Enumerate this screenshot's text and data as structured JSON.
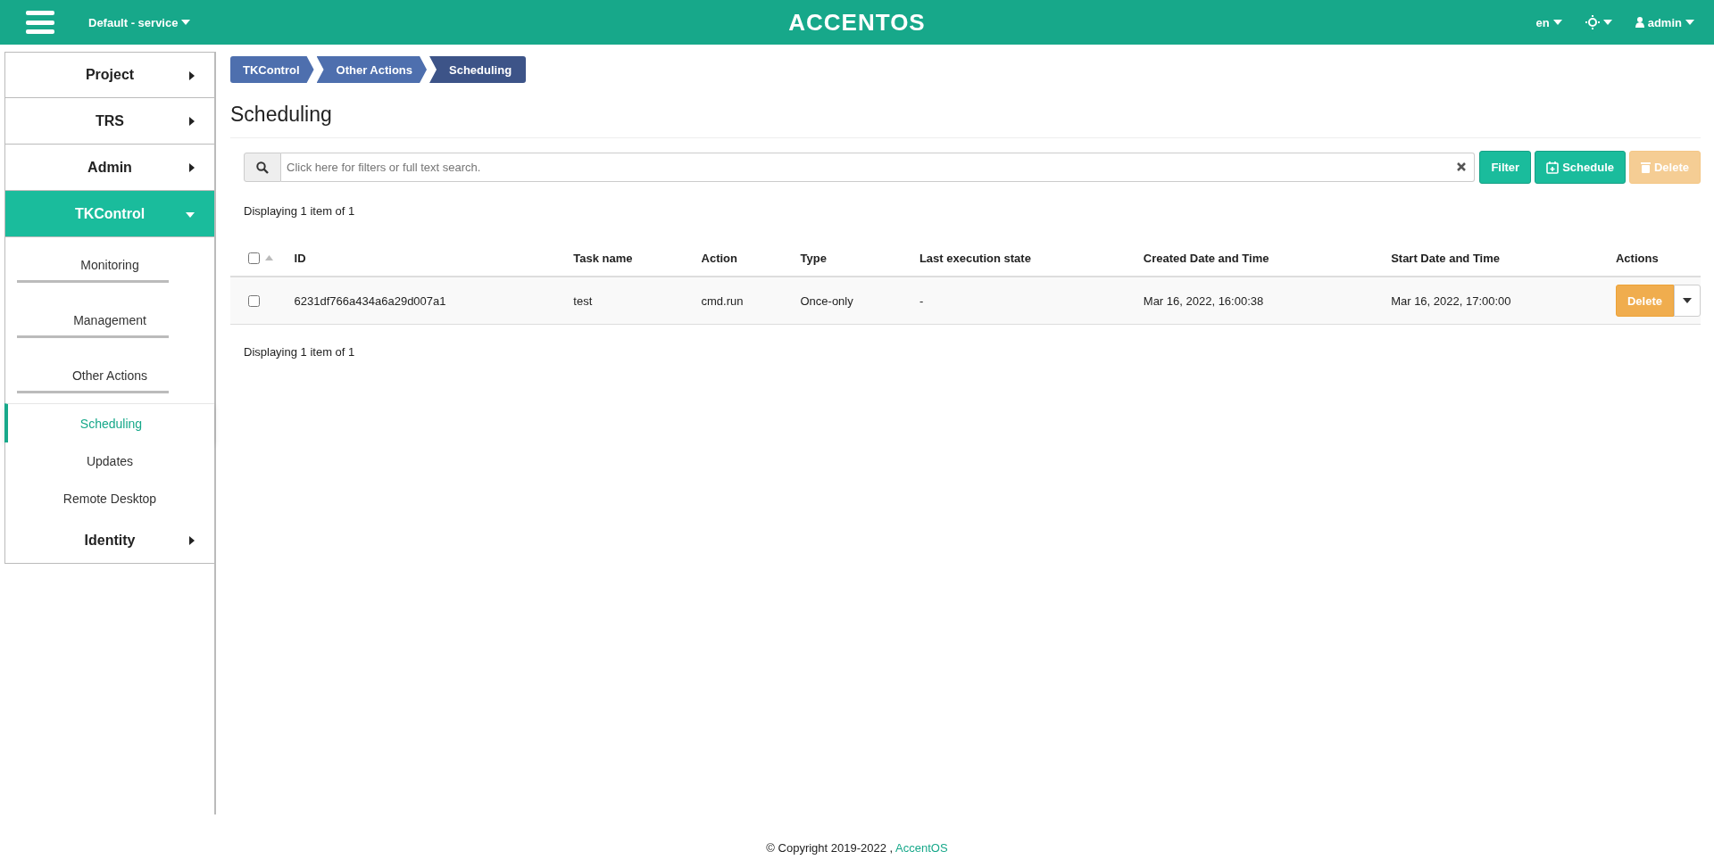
{
  "header": {
    "project": "Default - service",
    "logo": "ACCENTOS",
    "language": "en",
    "user": "admin"
  },
  "sidebar": {
    "items": [
      {
        "label": "Project",
        "expanded": false,
        "selected": false
      },
      {
        "label": "TRS",
        "expanded": false,
        "selected": false
      },
      {
        "label": "Admin",
        "expanded": false,
        "selected": false
      },
      {
        "label": "TKControl",
        "expanded": true,
        "selected": true,
        "children": [
          {
            "label": "Monitoring",
            "kind": "group"
          },
          {
            "label": "Management",
            "kind": "group"
          },
          {
            "label": "Other Actions",
            "kind": "group"
          },
          {
            "label": "Scheduling",
            "kind": "link",
            "selected": true
          },
          {
            "label": "Updates",
            "kind": "link",
            "selected": false
          },
          {
            "label": "Remote Desktop",
            "kind": "link",
            "selected": false
          }
        ]
      },
      {
        "label": "Identity",
        "expanded": false,
        "selected": false
      }
    ]
  },
  "breadcrumb": [
    {
      "label": "TKControl",
      "current": false
    },
    {
      "label": "Other Actions",
      "current": false
    },
    {
      "label": "Scheduling",
      "current": true
    }
  ],
  "page_title": "Scheduling",
  "toolbar": {
    "search": {
      "placeholder": "Click here for filters or full text search."
    },
    "buttons": [
      {
        "label": "Filter",
        "kind": "filter",
        "disabled": false
      },
      {
        "label": "Schedule",
        "kind": "schedule",
        "disabled": false
      },
      {
        "label": "Delete",
        "kind": "delete",
        "disabled": true
      }
    ]
  },
  "summary_top": "Displaying 1 item of 1",
  "table": {
    "select_all_checked": false,
    "columns": [
      "ID",
      "Task name",
      "Action",
      "Type",
      "Last execution state",
      "Created Date and Time",
      "Start Date and Time",
      "Actions"
    ],
    "rows": [
      {
        "checked": false,
        "cells": [
          "6231df766a434a6a29d007a1",
          "test",
          "cmd.run",
          "Once-only",
          "-",
          "Mar 16, 2022, 16:00:38",
          "Mar 16, 2022, 17:00:00"
        ],
        "action": "Delete"
      }
    ]
  },
  "summary_bottom": "Displaying 1 item of 1",
  "footer": {
    "text": "© Copyright 2019-2022 ,",
    "link": "AccentOS"
  }
}
